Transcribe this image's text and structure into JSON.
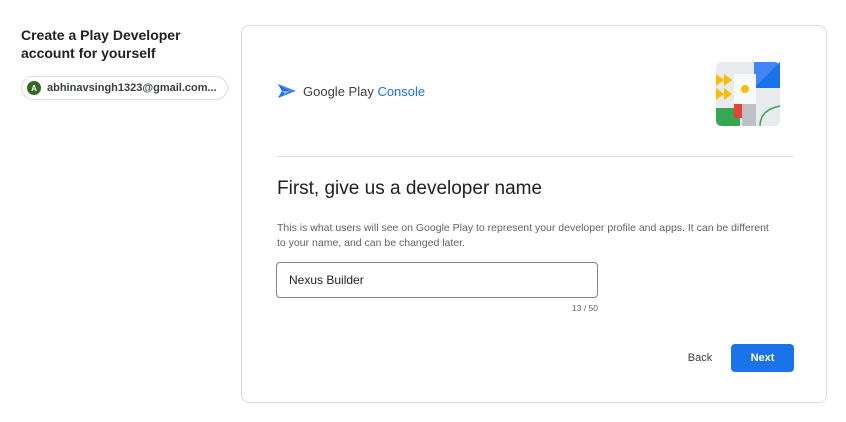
{
  "sidebar": {
    "title": "Create a Play Developer account for yourself",
    "account": {
      "avatar_initial": "A",
      "email": "abhinavsingh1323@gmail.com..."
    }
  },
  "card": {
    "brand": {
      "name_prefix": "Google Play",
      "name_suffix": " Console",
      "logo_icon": "play-console-logo-icon"
    },
    "illustration_icon": "play-console-hero-icon",
    "heading": "First, give us a developer name",
    "description": "This is what users will see on Google Play to represent your developer profile and apps. It can be different to your name, and can be changed later.",
    "name_field": {
      "value": "Nexus Builder",
      "counter": "13 / 50"
    },
    "actions": {
      "back_label": "Back",
      "next_label": "Next"
    }
  },
  "colors": {
    "accent": "#1a73e8",
    "avatar": "#33691e",
    "border": "#dadce0"
  }
}
